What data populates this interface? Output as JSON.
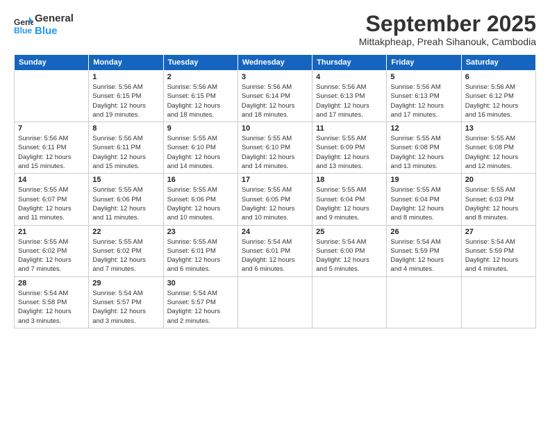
{
  "header": {
    "logo": {
      "line1": "General",
      "line2": "Blue"
    },
    "title": "September 2025",
    "subtitle": "Mittakpheap, Preah Sihanouk, Cambodia"
  },
  "days_of_week": [
    "Sunday",
    "Monday",
    "Tuesday",
    "Wednesday",
    "Thursday",
    "Friday",
    "Saturday"
  ],
  "weeks": [
    [
      {
        "day": "",
        "info": ""
      },
      {
        "day": "1",
        "info": "Sunrise: 5:56 AM\nSunset: 6:15 PM\nDaylight: 12 hours\nand 19 minutes."
      },
      {
        "day": "2",
        "info": "Sunrise: 5:56 AM\nSunset: 6:15 PM\nDaylight: 12 hours\nand 18 minutes."
      },
      {
        "day": "3",
        "info": "Sunrise: 5:56 AM\nSunset: 6:14 PM\nDaylight: 12 hours\nand 18 minutes."
      },
      {
        "day": "4",
        "info": "Sunrise: 5:56 AM\nSunset: 6:13 PM\nDaylight: 12 hours\nand 17 minutes."
      },
      {
        "day": "5",
        "info": "Sunrise: 5:56 AM\nSunset: 6:13 PM\nDaylight: 12 hours\nand 17 minutes."
      },
      {
        "day": "6",
        "info": "Sunrise: 5:56 AM\nSunset: 6:12 PM\nDaylight: 12 hours\nand 16 minutes."
      }
    ],
    [
      {
        "day": "7",
        "info": "Sunrise: 5:56 AM\nSunset: 6:11 PM\nDaylight: 12 hours\nand 15 minutes."
      },
      {
        "day": "8",
        "info": "Sunrise: 5:56 AM\nSunset: 6:11 PM\nDaylight: 12 hours\nand 15 minutes."
      },
      {
        "day": "9",
        "info": "Sunrise: 5:55 AM\nSunset: 6:10 PM\nDaylight: 12 hours\nand 14 minutes."
      },
      {
        "day": "10",
        "info": "Sunrise: 5:55 AM\nSunset: 6:10 PM\nDaylight: 12 hours\nand 14 minutes."
      },
      {
        "day": "11",
        "info": "Sunrise: 5:55 AM\nSunset: 6:09 PM\nDaylight: 12 hours\nand 13 minutes."
      },
      {
        "day": "12",
        "info": "Sunrise: 5:55 AM\nSunset: 6:08 PM\nDaylight: 12 hours\nand 13 minutes."
      },
      {
        "day": "13",
        "info": "Sunrise: 5:55 AM\nSunset: 6:08 PM\nDaylight: 12 hours\nand 12 minutes."
      }
    ],
    [
      {
        "day": "14",
        "info": "Sunrise: 5:55 AM\nSunset: 6:07 PM\nDaylight: 12 hours\nand 11 minutes."
      },
      {
        "day": "15",
        "info": "Sunrise: 5:55 AM\nSunset: 6:06 PM\nDaylight: 12 hours\nand 11 minutes."
      },
      {
        "day": "16",
        "info": "Sunrise: 5:55 AM\nSunset: 6:06 PM\nDaylight: 12 hours\nand 10 minutes."
      },
      {
        "day": "17",
        "info": "Sunrise: 5:55 AM\nSunset: 6:05 PM\nDaylight: 12 hours\nand 10 minutes."
      },
      {
        "day": "18",
        "info": "Sunrise: 5:55 AM\nSunset: 6:04 PM\nDaylight: 12 hours\nand 9 minutes."
      },
      {
        "day": "19",
        "info": "Sunrise: 5:55 AM\nSunset: 6:04 PM\nDaylight: 12 hours\nand 8 minutes."
      },
      {
        "day": "20",
        "info": "Sunrise: 5:55 AM\nSunset: 6:03 PM\nDaylight: 12 hours\nand 8 minutes."
      }
    ],
    [
      {
        "day": "21",
        "info": "Sunrise: 5:55 AM\nSunset: 6:02 PM\nDaylight: 12 hours\nand 7 minutes."
      },
      {
        "day": "22",
        "info": "Sunrise: 5:55 AM\nSunset: 6:02 PM\nDaylight: 12 hours\nand 7 minutes."
      },
      {
        "day": "23",
        "info": "Sunrise: 5:55 AM\nSunset: 6:01 PM\nDaylight: 12 hours\nand 6 minutes."
      },
      {
        "day": "24",
        "info": "Sunrise: 5:54 AM\nSunset: 6:01 PM\nDaylight: 12 hours\nand 6 minutes."
      },
      {
        "day": "25",
        "info": "Sunrise: 5:54 AM\nSunset: 6:00 PM\nDaylight: 12 hours\nand 5 minutes."
      },
      {
        "day": "26",
        "info": "Sunrise: 5:54 AM\nSunset: 5:59 PM\nDaylight: 12 hours\nand 4 minutes."
      },
      {
        "day": "27",
        "info": "Sunrise: 5:54 AM\nSunset: 5:59 PM\nDaylight: 12 hours\nand 4 minutes."
      }
    ],
    [
      {
        "day": "28",
        "info": "Sunrise: 5:54 AM\nSunset: 5:58 PM\nDaylight: 12 hours\nand 3 minutes."
      },
      {
        "day": "29",
        "info": "Sunrise: 5:54 AM\nSunset: 5:57 PM\nDaylight: 12 hours\nand 3 minutes."
      },
      {
        "day": "30",
        "info": "Sunrise: 5:54 AM\nSunset: 5:57 PM\nDaylight: 12 hours\nand 2 minutes."
      },
      {
        "day": "",
        "info": ""
      },
      {
        "day": "",
        "info": ""
      },
      {
        "day": "",
        "info": ""
      },
      {
        "day": "",
        "info": ""
      }
    ]
  ]
}
